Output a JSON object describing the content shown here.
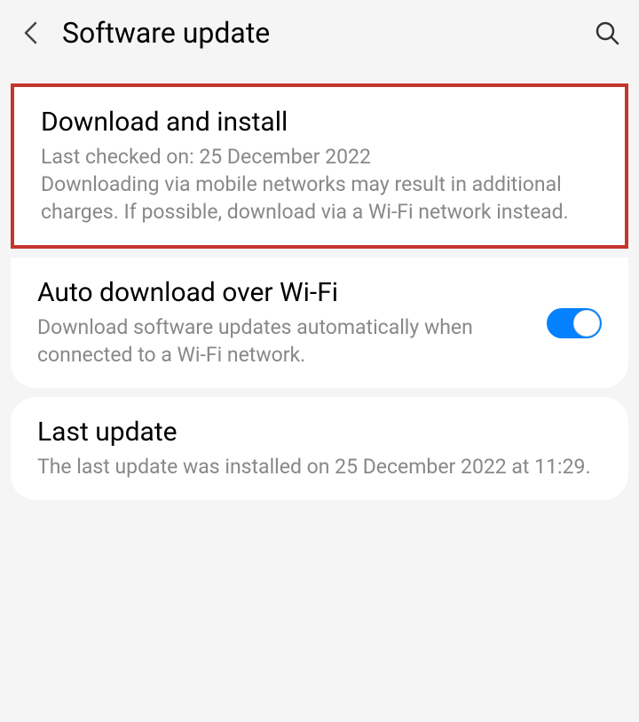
{
  "header": {
    "title": "Software update"
  },
  "items": {
    "download": {
      "title": "Download and install",
      "lastChecked": "Last checked on: 25 December 2022",
      "warning": "Downloading via mobile networks may result in additional charges. If possible, download via a Wi-Fi network instead."
    },
    "autoDownload": {
      "title": "Auto download over Wi-Fi",
      "description": "Download software updates automatically when connected to a Wi-Fi network."
    },
    "lastUpdate": {
      "title": "Last update",
      "description": "The last update was installed on 25 December 2022 at 11:29."
    }
  }
}
